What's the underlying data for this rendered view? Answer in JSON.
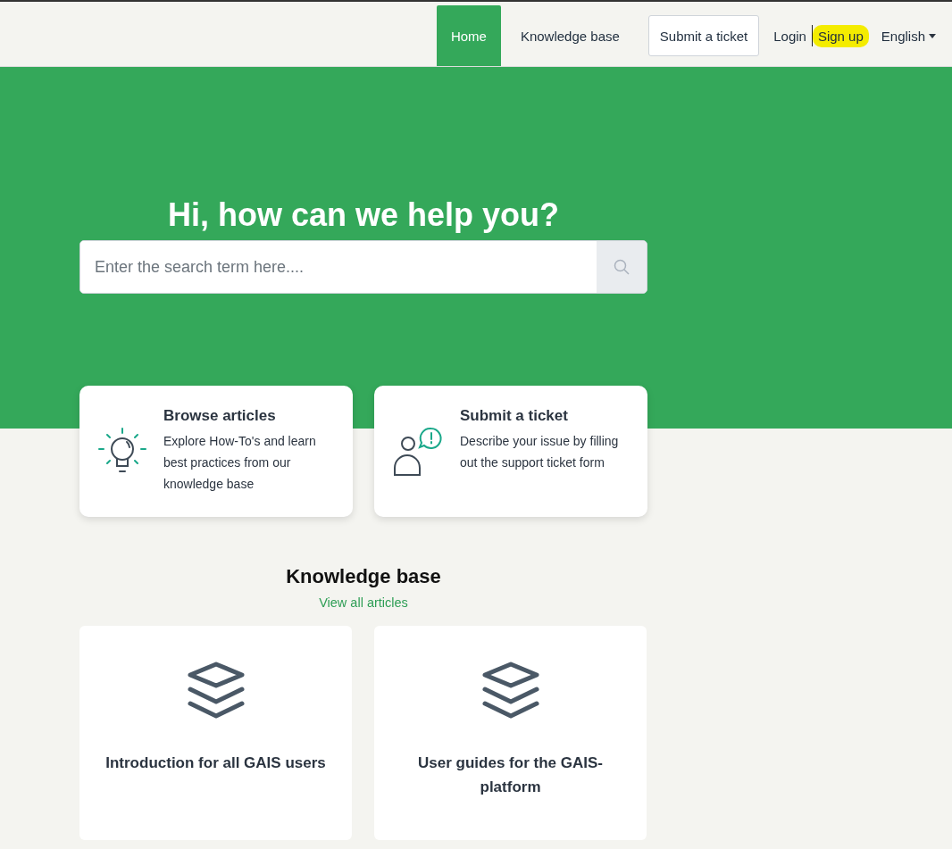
{
  "nav": [
    {
      "label": "Home",
      "kind": "tab",
      "selected": true,
      "highlighted": false
    },
    {
      "label": "Knowledge base",
      "kind": "tab",
      "selected": false,
      "highlighted": false
    },
    {
      "label": "Submit a ticket",
      "kind": "button",
      "selected": false,
      "highlighted": false
    },
    {
      "label": "Login",
      "kind": "link",
      "selected": false,
      "highlighted": false
    },
    {
      "label": "Sign up",
      "kind": "link",
      "selected": false,
      "highlighted": true
    },
    {
      "label": "English",
      "kind": "dropdown",
      "selected": false,
      "highlighted": false
    }
  ],
  "hero": {
    "title": "Hi, how can we help you?",
    "search": {
      "placeholder": "Enter the search term here...."
    }
  },
  "actions": [
    {
      "kind": "bulb",
      "title": "Browse articles",
      "text": "Explore How-To's and learn best practices from our knowledge base"
    },
    {
      "kind": "ticket",
      "title": "Submit a ticket",
      "text": "Describe your issue by filling out the support ticket form"
    }
  ],
  "knowledge_base": {
    "title": "Knowledge base",
    "link": "View all articles",
    "categories": [
      {
        "title": "Introduction for all GAIS users"
      },
      {
        "title": "User guides for the GAIS-platform"
      }
    ]
  }
}
